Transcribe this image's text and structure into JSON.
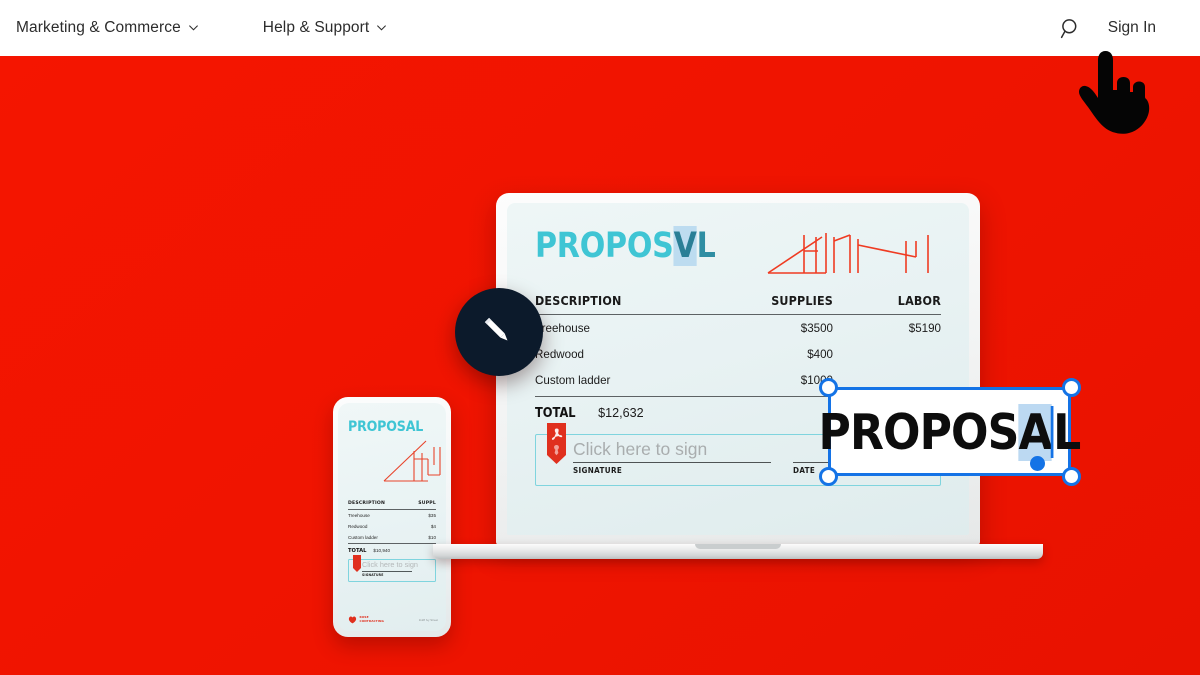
{
  "header": {
    "nav_items": [
      {
        "label": "Marketing & Commerce",
        "icon": "chevron-down-icon"
      },
      {
        "label": "Help & Support",
        "icon": "chevron-down-icon"
      }
    ],
    "search_icon": "search-icon",
    "sign_in_label": "Sign In"
  },
  "hero": {
    "background_color_dark": "#c21407",
    "background_color_bright": "#f01500"
  },
  "fab": {
    "icon": "pencil-icon",
    "background_color": "#0c1a2b"
  },
  "laptop_document": {
    "title_main": "PROPOS",
    "title_selected_char": "V",
    "title_tail": "L",
    "sketch_icon": "treehouse-line-sketch-icon",
    "table": {
      "headers": [
        "DESCRIPTION",
        "SUPPLIES",
        "LABOR"
      ],
      "rows": [
        {
          "description": "Treehouse",
          "supplies": "$3500",
          "labor": "$5190"
        },
        {
          "description": "Redwood",
          "supplies": "$400",
          "labor": ""
        },
        {
          "description": "Custom ladder",
          "supplies": "$1000",
          "labor": ""
        }
      ]
    },
    "total_label": "TOTAL",
    "total_value": "$12,632",
    "signature": {
      "pdf_icon": "adobe-pdf-ribbon-icon",
      "placeholder": "Click here to sign",
      "signature_caption": "SIGNATURE",
      "date_caption": "DATE"
    }
  },
  "phone_document": {
    "title": "PROPOSAL",
    "sketch_icon": "treehouse-line-sketch-icon",
    "table": {
      "headers": [
        "DESCRIPTION",
        "SUPPL"
      ],
      "rows": [
        {
          "description": "Treehouse",
          "supplies": "$35"
        },
        {
          "description": "Redwood",
          "supplies": "$4"
        },
        {
          "description": "Custom ladder",
          "supplies": "$10"
        }
      ]
    },
    "total_label": "TOTAL",
    "total_value": "$10,940",
    "signature": {
      "pdf_icon": "adobe-pdf-ribbon-icon",
      "placeholder": "Click here to sign",
      "signature_caption": "SIGNATURE"
    },
    "footer": {
      "logo_icon": "company-logo-icon",
      "logo_line1": "ROSE",
      "logo_line2": "CONTRACTING",
      "address": "1128 Ivy Street"
    }
  },
  "selected_textbox": {
    "text_before": "PROPOS",
    "text_selected": "A",
    "text_after": "L",
    "selection_color": "#bcd9f2",
    "border_color": "#1473e6",
    "handles": [
      "top-left",
      "top-right",
      "bottom-left",
      "bottom-right"
    ],
    "anchor_handle": "text-anchor-handle"
  },
  "cursor": {
    "icon": "pointing-hand-cursor-icon"
  }
}
